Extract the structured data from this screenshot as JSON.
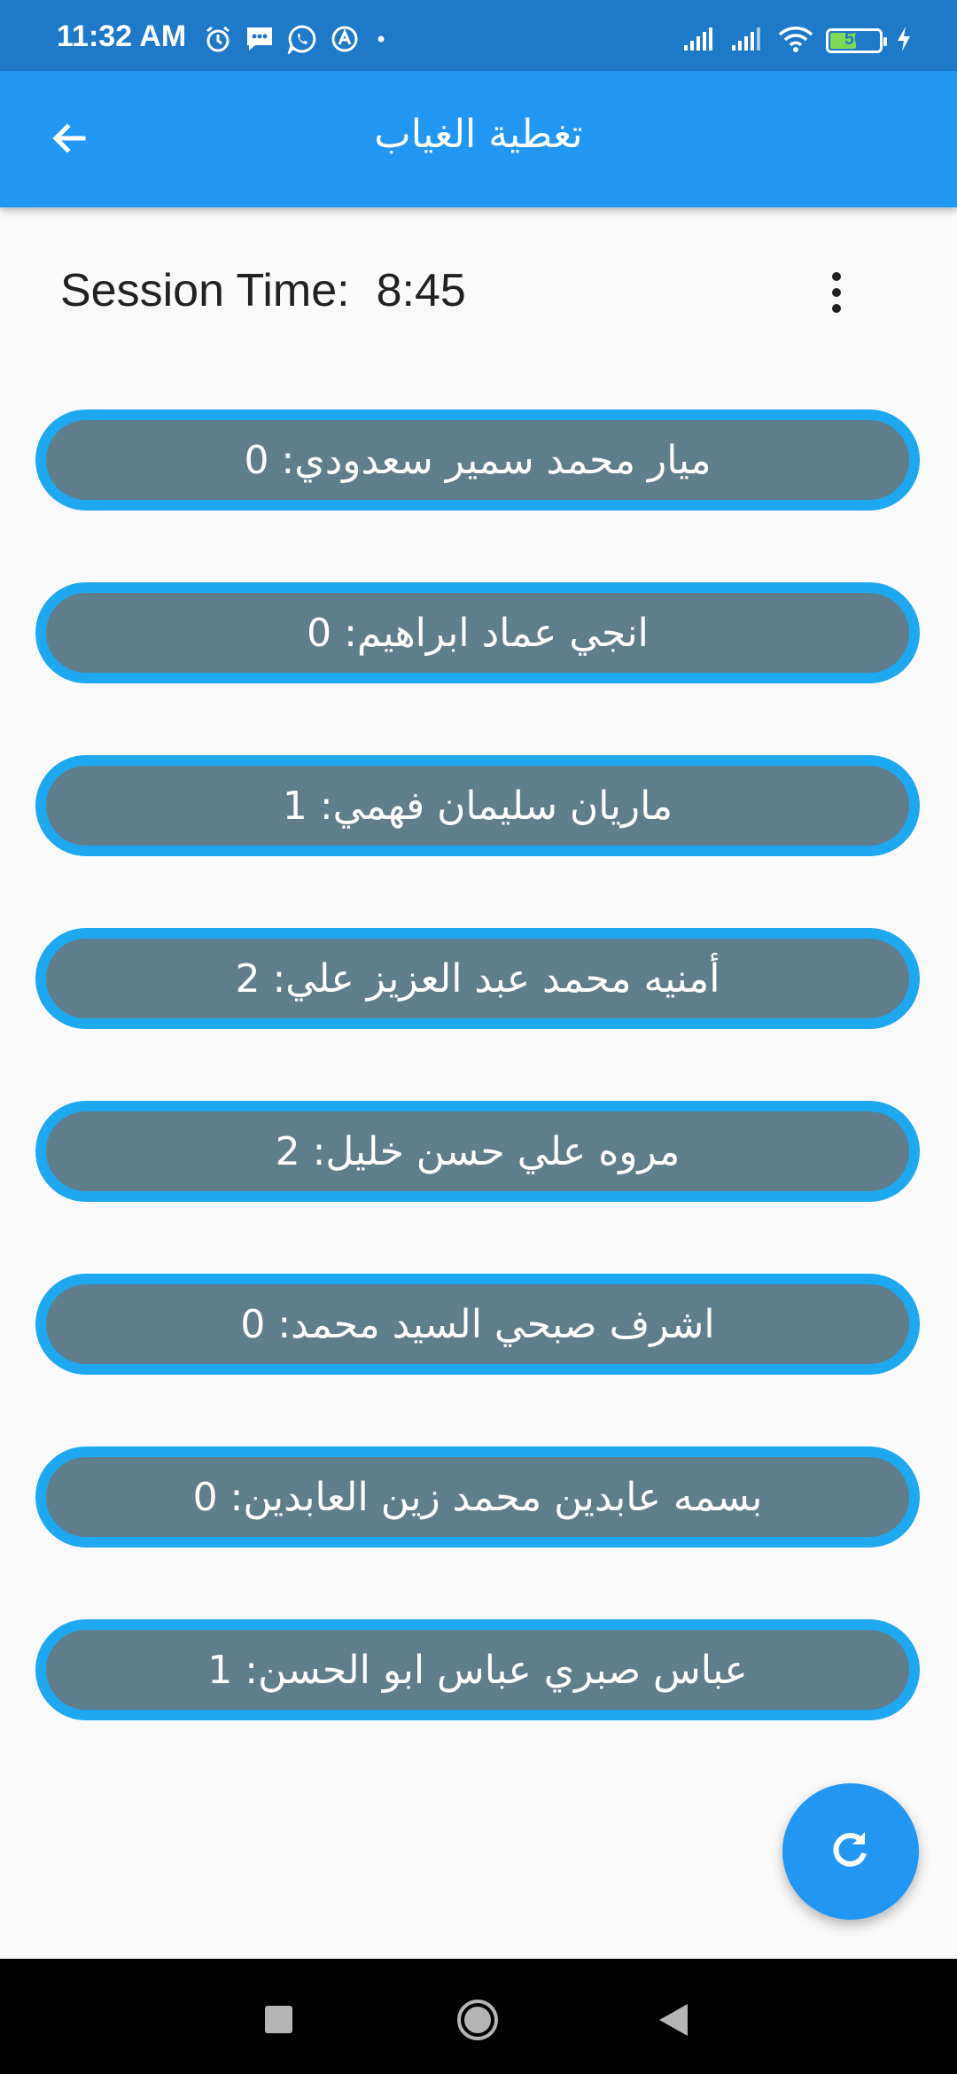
{
  "status_bar": {
    "time": "11:32 AM",
    "battery_level": "50",
    "icons_left": [
      "alarm-icon",
      "message-icon",
      "whatsapp-icon",
      "app-notification-icon",
      "dot-icon"
    ],
    "icons_right": [
      "signal-icon",
      "signal-icon-2",
      "wifi-icon",
      "battery-icon",
      "charging-icon"
    ]
  },
  "app_bar": {
    "title": "تغطية الغياب",
    "back_icon": "arrow-back-icon"
  },
  "session": {
    "label": "Session Time:",
    "value": "8:45",
    "menu_icon": "more-vert-icon"
  },
  "students": [
    {
      "text": "ميار محمد سمير سعدودي: 0"
    },
    {
      "text": "انجي عماد ابراهيم: 0"
    },
    {
      "text": "ماريان سليمان فهمي: 1"
    },
    {
      "text": "أمنيه محمد عبد العزيز علي: 2"
    },
    {
      "text": "مروه علي حسن خليل: 2"
    },
    {
      "text": "اشرف صبحي السيد محمد: 0"
    },
    {
      "text": "بسمه عابدين محمد زين العابدين: 0"
    },
    {
      "text": "عباس صبري عباس ابو الحسن: 1"
    }
  ],
  "fab": {
    "icon": "refresh-icon"
  },
  "nav_bar": {
    "icons": [
      "recents-icon",
      "home-icon",
      "back-icon"
    ]
  },
  "colors": {
    "status_bar": "#1e79c9",
    "app_bar": "#2196f3",
    "pill_fill": "#607d8b",
    "pill_border": "#1ea8f0",
    "fab": "#2196f3",
    "background": "#fafafa"
  }
}
